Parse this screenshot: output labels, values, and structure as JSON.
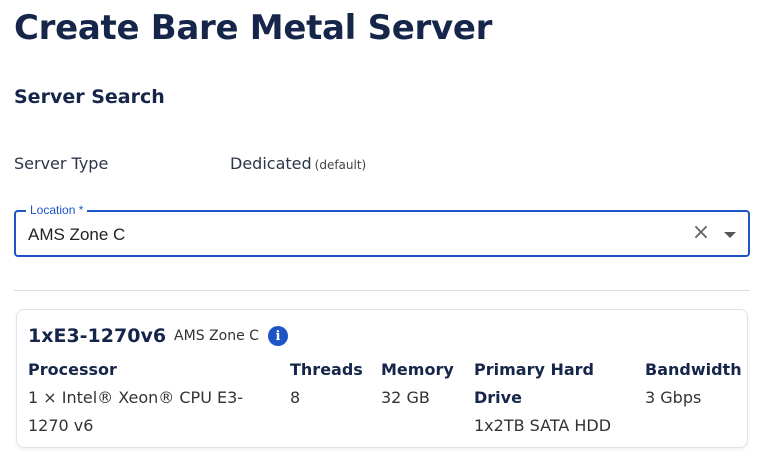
{
  "page": {
    "title": "Create Bare Metal Server"
  },
  "search": {
    "section_title": "Server Search",
    "server_type_label": "Server Type",
    "server_type_value": "Dedicated",
    "server_type_default": "(default)",
    "location_label": "Location *",
    "location_value": "AMS Zone C"
  },
  "server": {
    "name": "1xE3-1270v6",
    "location": "AMS Zone C",
    "specs": {
      "processor_label": "Processor",
      "processor_value": "1 × Intel® Xeon® CPU E3-1270 v6",
      "threads_label": "Threads",
      "threads_value": "8",
      "memory_label": "Memory",
      "memory_value": "32 GB",
      "drive_label": "Primary Hard Drive",
      "drive_value": "1x2TB SATA HDD",
      "bandwidth_label": "Bandwidth",
      "bandwidth_value": "3 Gbps"
    }
  },
  "icons": {
    "clear": "close-icon",
    "dropdown": "chevron-down-icon",
    "info": "info-icon"
  },
  "colors": {
    "accent": "#1d55c6",
    "heading": "#15264a"
  }
}
